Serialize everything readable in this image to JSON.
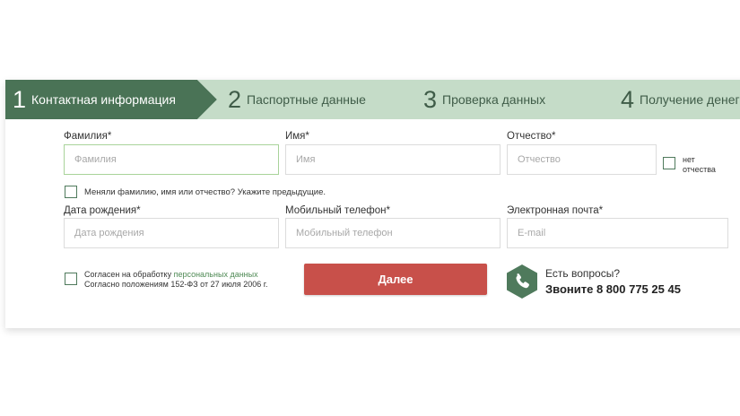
{
  "steps": [
    {
      "num": "1",
      "label": "Контактная информация"
    },
    {
      "num": "2",
      "label": "Паспортные данные"
    },
    {
      "num": "3",
      "label": "Проверка данных"
    },
    {
      "num": "4",
      "label": "Получение денег"
    }
  ],
  "form": {
    "surname": {
      "label": "Фамилия*",
      "placeholder": "Фамилия"
    },
    "name": {
      "label": "Имя*",
      "placeholder": "Имя"
    },
    "patronymic": {
      "label": "Отчество*",
      "placeholder": "Отчество"
    },
    "no_patronymic": {
      "line1": "нет",
      "line2": "отчества"
    },
    "changed_name": "Меняли фамилию, имя или отчество? Укажите предыдущие.",
    "birthdate": {
      "label": "Дата рождения*",
      "placeholder": "Дата рождения"
    },
    "phone": {
      "label": "Мобильный телефон*",
      "placeholder": "Мобильный телефон"
    },
    "email": {
      "label": "Электронная почта*",
      "placeholder": "E-mail"
    },
    "consent": {
      "prefix": "Согласен на обработку ",
      "link": "персональных данных",
      "line2": "Согласно положениям 152-ФЗ от 27 июля 2006 г."
    },
    "submit": "Далее"
  },
  "contact": {
    "question": "Есть вопросы?",
    "call": "Звоните 8 800 775 25 45"
  },
  "colors": {
    "active_step": "#4a7356",
    "inactive_step": "#c5dcc8",
    "button": "#c8504a",
    "accent": "#4f7a5c"
  },
  "icons": {
    "phone": "phone-icon"
  }
}
